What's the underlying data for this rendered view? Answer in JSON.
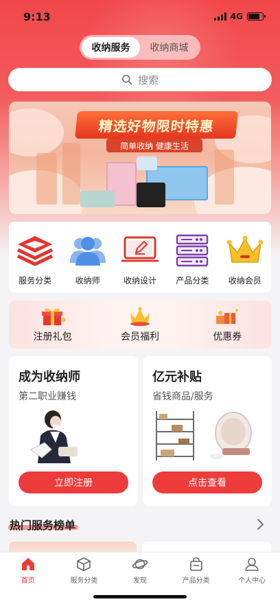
{
  "status_bar": {
    "time": "9:13",
    "network": "4G"
  },
  "header": {
    "tabs": [
      {
        "label": "收纳服务",
        "active": true
      },
      {
        "label": "收纳商城",
        "active": false
      }
    ],
    "search_placeholder": "搜索"
  },
  "banner": {
    "title": "精选好物限时特惠",
    "subtitle": "简单收纳 健康生活"
  },
  "quick_menu": [
    {
      "label": "服务分类",
      "icon": "layers-icon"
    },
    {
      "label": "收纳师",
      "icon": "users-icon"
    },
    {
      "label": "收纳设计",
      "icon": "monitor-pen-icon"
    },
    {
      "label": "产品分类",
      "icon": "server-icon"
    },
    {
      "label": "收纳会员",
      "icon": "crown-icon"
    }
  ],
  "gifts": [
    {
      "label": "注册礼包",
      "icon": "gift-box-icon"
    },
    {
      "label": "会员福利",
      "icon": "crown-gift-icon"
    },
    {
      "label": "优惠券",
      "icon": "coupon-gift-icon"
    }
  ],
  "promo_cards": [
    {
      "title": "成为收纳师",
      "subtitle": "第二职业赚钱",
      "button": "立即注册"
    },
    {
      "title": "亿元补贴",
      "subtitle": "省钱商品/服务",
      "button": "点击查看"
    }
  ],
  "section": {
    "title": "热门服务榜单"
  },
  "tabbar": [
    {
      "label": "首页",
      "icon": "home-icon",
      "active": true
    },
    {
      "label": "服务分类",
      "icon": "cube-icon",
      "active": false
    },
    {
      "label": "发现",
      "icon": "planet-icon",
      "active": false
    },
    {
      "label": "产品分类",
      "icon": "bag-icon",
      "active": false
    },
    {
      "label": "个人中心",
      "icon": "user-icon",
      "active": false
    }
  ],
  "colors": {
    "accent": "#ee3b3b",
    "header_red": "#f2474a"
  }
}
